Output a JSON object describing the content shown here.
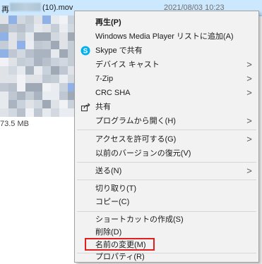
{
  "file_row": {
    "name_prefix": "再",
    "name_suffix": "(10).mov",
    "date": "2021/08/03 10:23"
  },
  "thumbnail": {
    "size_label": "73.5 MB"
  },
  "context_menu": {
    "items": [
      {
        "label": "再生(P)",
        "bold": true
      },
      {
        "label": "Windows Media Player リストに追加(A)"
      },
      {
        "label": "Skype で共有",
        "icon": "skype-icon"
      },
      {
        "label": "デバイス キャスト",
        "submenu": true
      },
      {
        "label": "7-Zip",
        "submenu": true
      },
      {
        "label": "CRC SHA",
        "submenu": true
      },
      {
        "label": "共有",
        "icon": "share-icon"
      },
      {
        "label": "プログラムから開く(H)",
        "submenu": true
      },
      {
        "label": "アクセスを許可する(G)",
        "submenu": true
      },
      {
        "label": "以前のバージョンの復元(V)"
      },
      {
        "label": "送る(N)",
        "submenu": true
      },
      {
        "label": "切り取り(T)"
      },
      {
        "label": "コピー(C)"
      },
      {
        "label": "ショートカットの作成(S)"
      },
      {
        "label": "削除(D)"
      },
      {
        "label": "名前の変更(M)",
        "highlighted": true
      },
      {
        "label": "プロパティ(R)"
      }
    ],
    "arrow_glyph": ">",
    "highlight_color": "#e0201f"
  },
  "colors": {
    "menu_bg": "#f2f2f2",
    "selection_bg": "#cce8ff",
    "skype_blue": "#00aff0"
  }
}
